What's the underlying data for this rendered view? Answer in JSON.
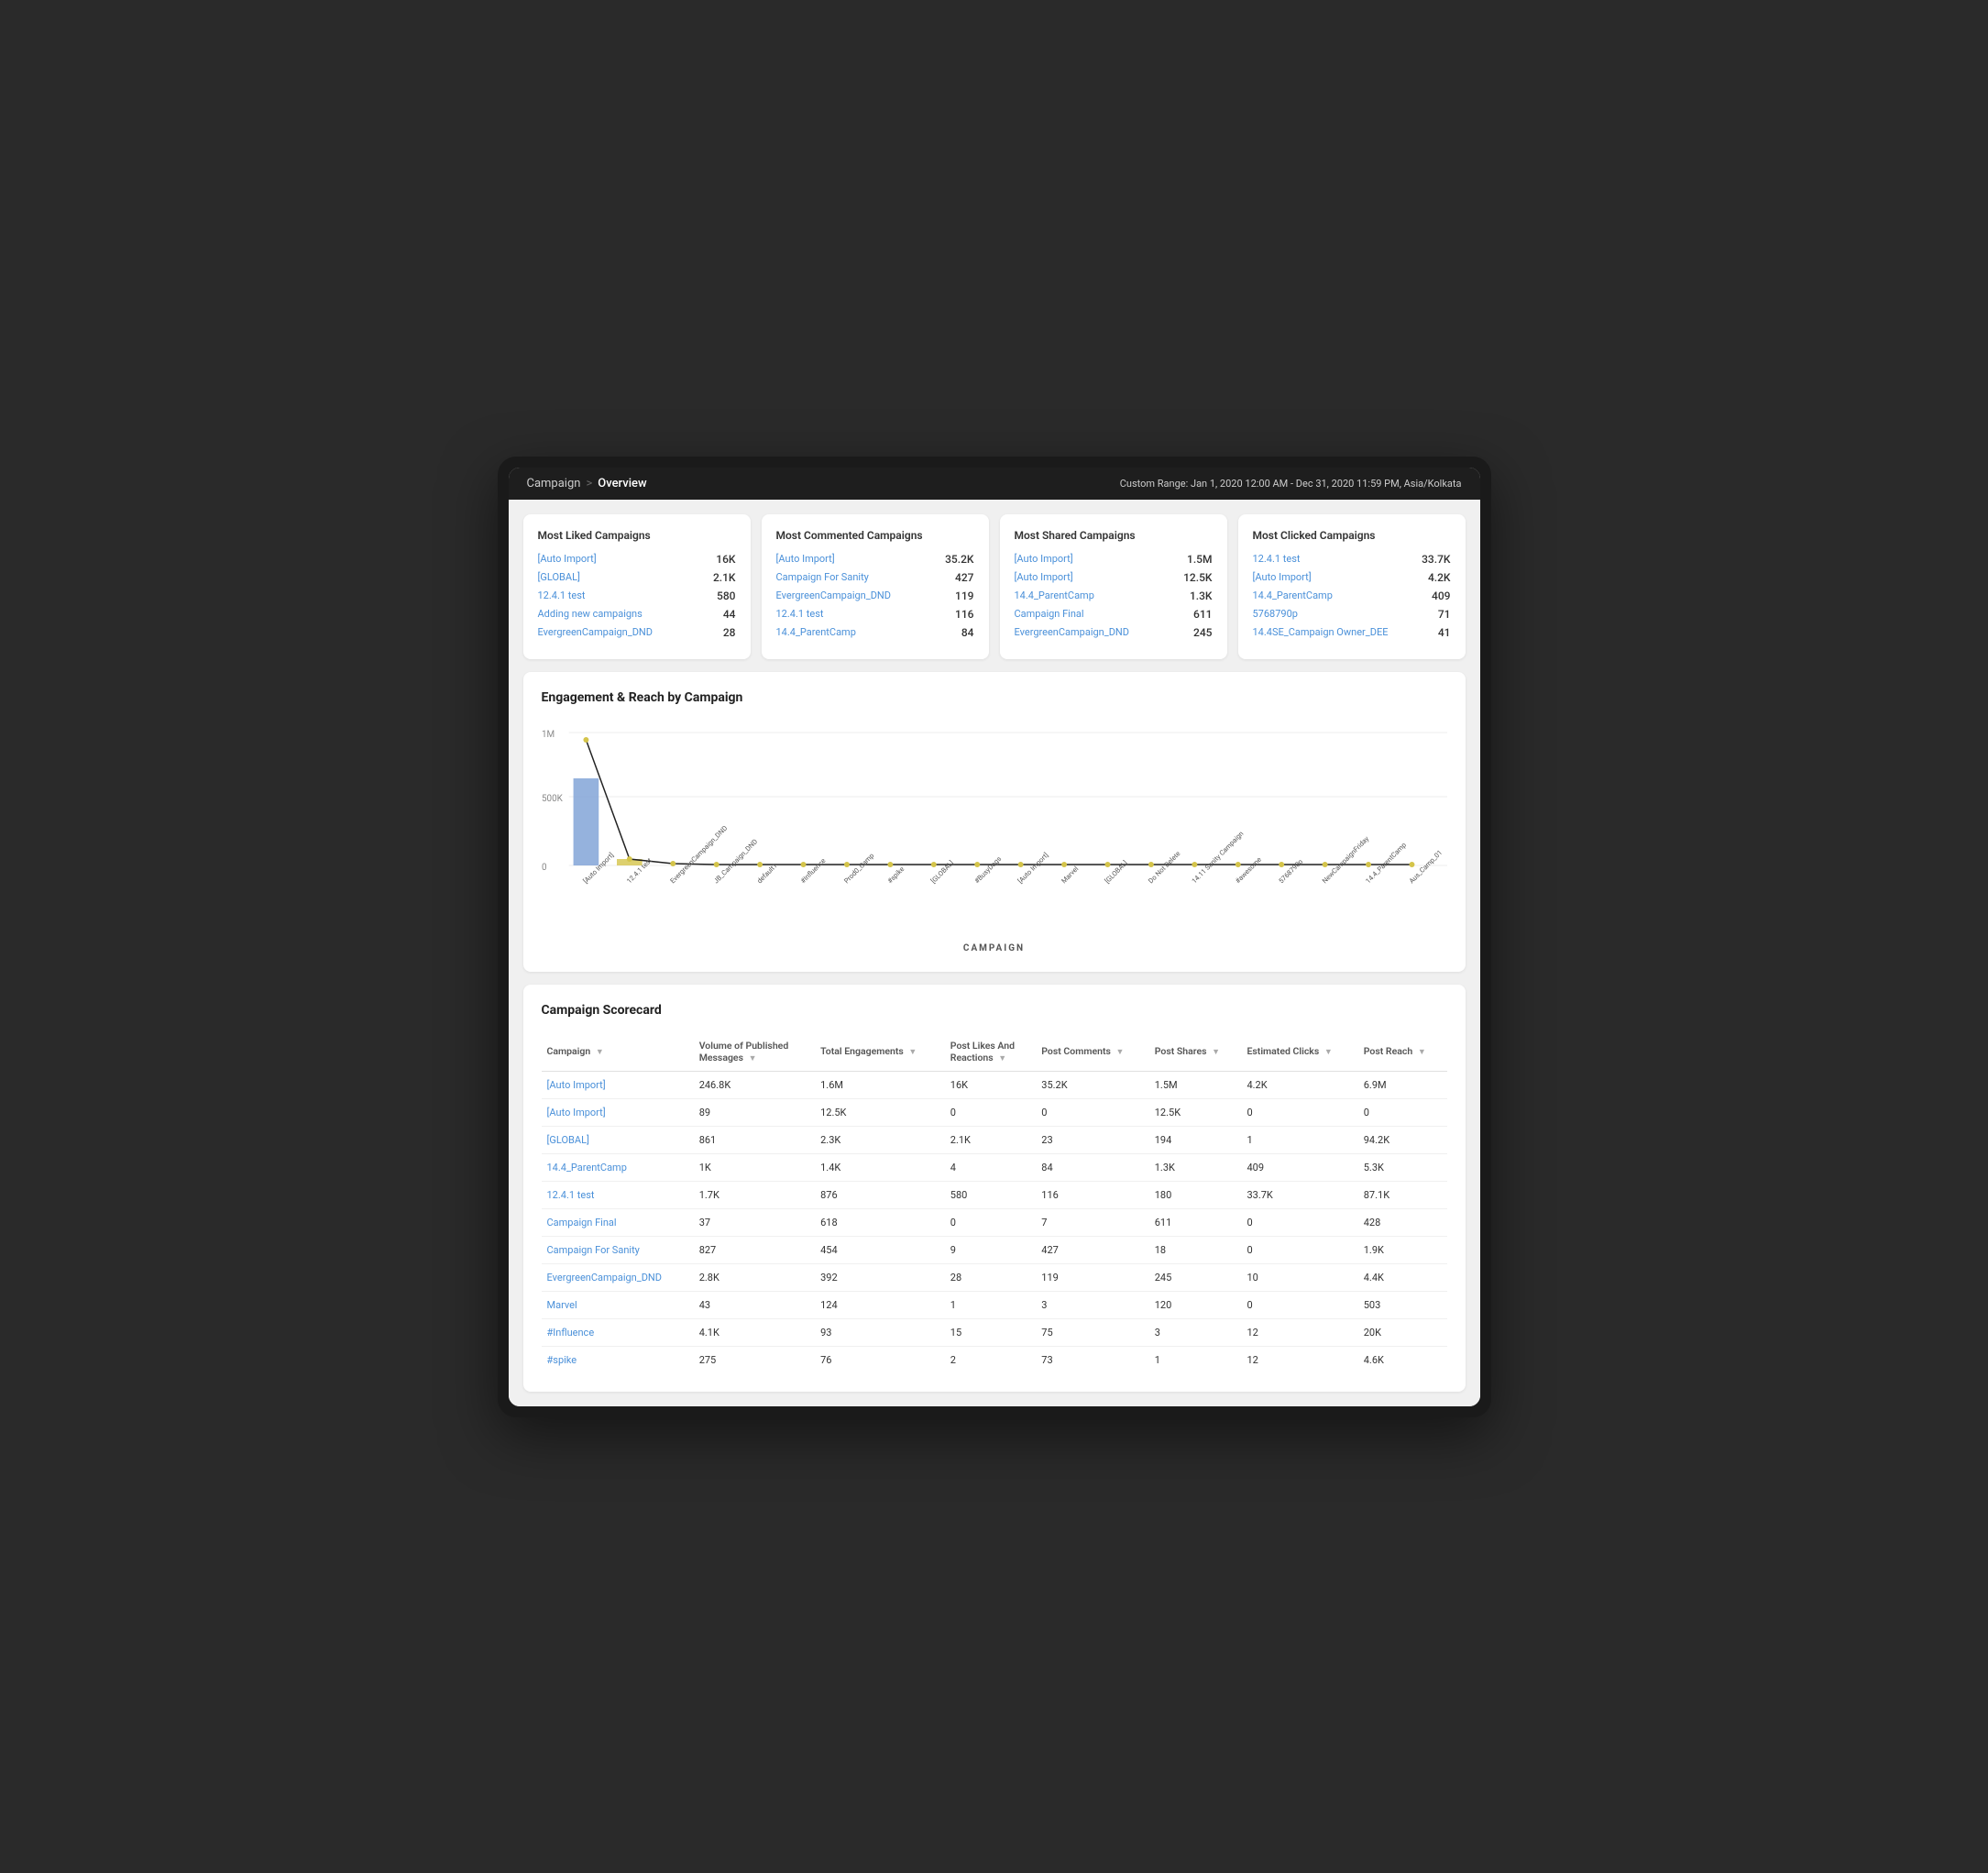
{
  "header": {
    "breadcrumb_parent": "Campaign",
    "breadcrumb_sep": ">",
    "breadcrumb_current": "Overview",
    "date_range": "Custom Range: Jan 1, 2020 12:00 AM - Dec 31, 2020 11:59 PM, Asia/Kolkata"
  },
  "most_liked": {
    "title": "Most Liked Campaigns",
    "items": [
      {
        "name": "[Auto Import]",
        "value": "16K"
      },
      {
        "name": "[GLOBAL]",
        "value": "2.1K"
      },
      {
        "name": "12.4.1 test",
        "value": "580"
      },
      {
        "name": "Adding new campaigns",
        "value": "44"
      },
      {
        "name": "EvergreenCampaign_DND",
        "value": "28"
      }
    ]
  },
  "most_commented": {
    "title": "Most Commented Campaigns",
    "items": [
      {
        "name": "[Auto Import]",
        "value": "35.2K"
      },
      {
        "name": "Campaign For Sanity",
        "value": "427"
      },
      {
        "name": "EvergreenCampaign_DND",
        "value": "119"
      },
      {
        "name": "12.4.1 test",
        "value": "116"
      },
      {
        "name": "14.4_ParentCamp",
        "value": "84"
      }
    ]
  },
  "most_shared": {
    "title": "Most Shared Campaigns",
    "items": [
      {
        "name": "[Auto Import]",
        "value": "1.5M"
      },
      {
        "name": "[Auto Import]",
        "value": "12.5K"
      },
      {
        "name": "14.4_ParentCamp",
        "value": "1.3K"
      },
      {
        "name": "Campaign Final",
        "value": "611"
      },
      {
        "name": "EvergreenCampaign_DND",
        "value": "245"
      }
    ]
  },
  "most_clicked": {
    "title": "Most Clicked Campaigns",
    "items": [
      {
        "name": "12.4.1 test",
        "value": "33.7K"
      },
      {
        "name": "[Auto Import]",
        "value": "4.2K"
      },
      {
        "name": "14.4_ParentCamp",
        "value": "409"
      },
      {
        "name": "5768790p",
        "value": "71"
      },
      {
        "name": "14.4SE_Campaign Owner_DEE",
        "value": "41"
      }
    ]
  },
  "engagement_chart": {
    "title": "Engagement & Reach by Campaign",
    "x_label": "CAMPAIGN",
    "y_labels": [
      "1M",
      "500K",
      "0"
    ],
    "x_labels": [
      "[Auto Import]",
      "12.4.1 test",
      "EvergreenCampaign_DND",
      "JB_Campaign_DND",
      "default1",
      "#influence",
      "Prod0_Camp",
      "#spike",
      "[GLOBAL]",
      "#BusyDogs",
      "[Auto Import]",
      "Marvel",
      "[GLOBAL]",
      "Do Not Delete",
      "14.11 Sanity Campaign",
      "#awesome",
      "5768790p",
      "NewCampaignFriday",
      "14.4_ParentCamp",
      "Aus_Camp_01"
    ]
  },
  "scorecard": {
    "title": "Campaign Scorecard",
    "columns": [
      {
        "label": "Campaign",
        "key": "campaign"
      },
      {
        "label": "Volume of Published Messages",
        "key": "volume"
      },
      {
        "label": "Total Engagements",
        "key": "total_eng"
      },
      {
        "label": "Post Likes And Reactions",
        "key": "likes"
      },
      {
        "label": "Post Comments",
        "key": "comments"
      },
      {
        "label": "Post Shares",
        "key": "shares"
      },
      {
        "label": "Estimated Clicks",
        "key": "clicks"
      },
      {
        "label": "Post Reach",
        "key": "reach"
      }
    ],
    "rows": [
      {
        "campaign": "[Auto Import]",
        "volume": "246.8K",
        "total_eng": "1.6M",
        "likes": "16K",
        "comments": "35.2K",
        "shares": "1.5M",
        "clicks": "4.2K",
        "reach": "6.9M"
      },
      {
        "campaign": "[Auto Import]",
        "volume": "89",
        "total_eng": "12.5K",
        "likes": "0",
        "comments": "0",
        "shares": "12.5K",
        "clicks": "0",
        "reach": "0"
      },
      {
        "campaign": "[GLOBAL]",
        "volume": "861",
        "total_eng": "2.3K",
        "likes": "2.1K",
        "comments": "23",
        "shares": "194",
        "clicks": "1",
        "reach": "94.2K"
      },
      {
        "campaign": "14.4_ParentCamp",
        "volume": "1K",
        "total_eng": "1.4K",
        "likes": "4",
        "comments": "84",
        "shares": "1.3K",
        "clicks": "409",
        "reach": "5.3K"
      },
      {
        "campaign": "12.4.1 test",
        "volume": "1.7K",
        "total_eng": "876",
        "likes": "580",
        "comments": "116",
        "shares": "180",
        "clicks": "33.7K",
        "reach": "87.1K"
      },
      {
        "campaign": "Campaign Final",
        "volume": "37",
        "total_eng": "618",
        "likes": "0",
        "comments": "7",
        "shares": "611",
        "clicks": "0",
        "reach": "428"
      },
      {
        "campaign": "Campaign For Sanity",
        "volume": "827",
        "total_eng": "454",
        "likes": "9",
        "comments": "427",
        "shares": "18",
        "clicks": "0",
        "reach": "1.9K"
      },
      {
        "campaign": "EvergreenCampaign_DND",
        "volume": "2.8K",
        "total_eng": "392",
        "likes": "28",
        "comments": "119",
        "shares": "245",
        "clicks": "10",
        "reach": "4.4K"
      },
      {
        "campaign": "Marvel",
        "volume": "43",
        "total_eng": "124",
        "likes": "1",
        "comments": "3",
        "shares": "120",
        "clicks": "0",
        "reach": "503"
      },
      {
        "campaign": "#Influence",
        "volume": "4.1K",
        "total_eng": "93",
        "likes": "15",
        "comments": "75",
        "shares": "3",
        "clicks": "12",
        "reach": "20K"
      },
      {
        "campaign": "#spike",
        "volume": "275",
        "total_eng": "76",
        "likes": "2",
        "comments": "73",
        "shares": "1",
        "clicks": "12",
        "reach": "4.6K"
      }
    ]
  }
}
